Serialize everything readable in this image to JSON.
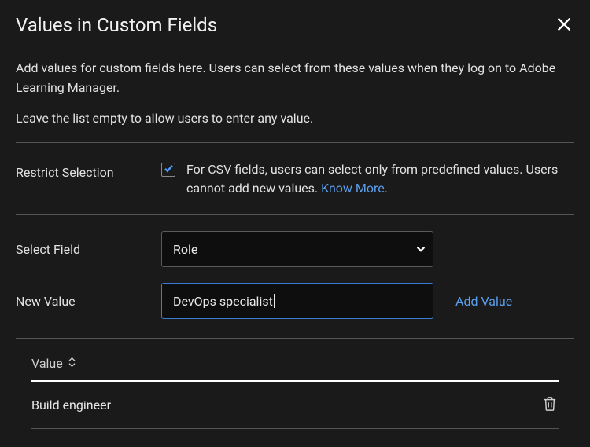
{
  "title": "Values in Custom Fields",
  "description": "Add values for custom fields here. Users can select from these values when they log on to Adobe Learning Manager.",
  "subdescription": "Leave the list empty to allow users to enter any value.",
  "restrict": {
    "label": "Restrict Selection",
    "checked": true,
    "text": "For CSV fields, users can select only from predefined values. Users cannot add new values. ",
    "know_more": "Know More."
  },
  "select_field": {
    "label": "Select Field",
    "value": "Role"
  },
  "new_value": {
    "label": "New Value",
    "value": "DevOps specialist",
    "add_label": "Add Value"
  },
  "values": {
    "header": "Value",
    "items": [
      {
        "name": "Build engineer"
      }
    ]
  }
}
